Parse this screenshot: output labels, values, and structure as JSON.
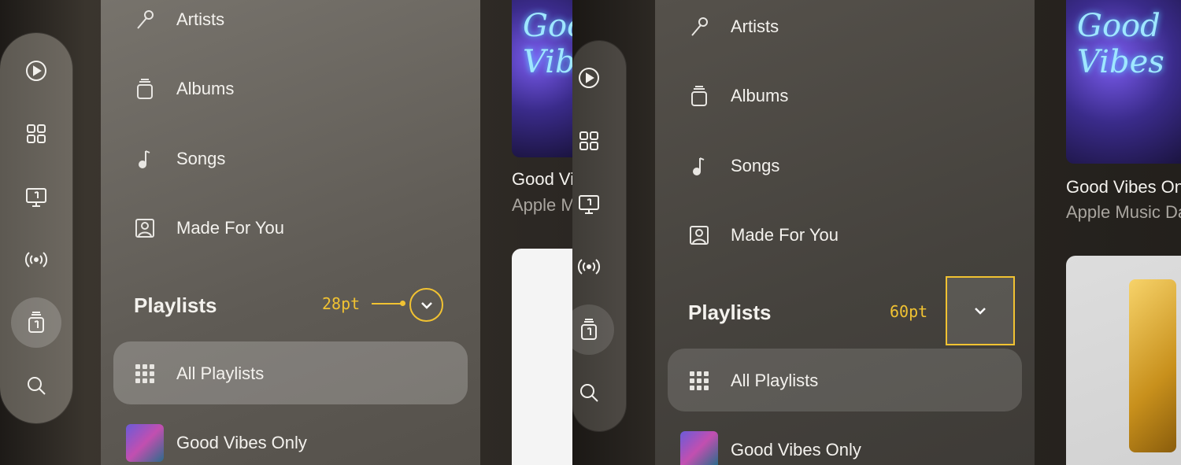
{
  "sidebar": {
    "items": [
      {
        "label": "Artists",
        "icon": "microphone-icon"
      },
      {
        "label": "Albums",
        "icon": "albums-icon"
      },
      {
        "label": "Songs",
        "icon": "music-note-icon"
      },
      {
        "label": "Made For You",
        "icon": "person-square-icon"
      }
    ],
    "playlists_heading": "Playlists",
    "all_playlists": "All Playlists",
    "playlist_1": "Good Vibes Only"
  },
  "tabs": [
    "play-icon",
    "grid-icon",
    "music-video-icon",
    "radio-icon",
    "library-icon",
    "search-icon"
  ],
  "annotations": {
    "left": "28pt",
    "right": "60pt",
    "color": "#f1c232"
  },
  "content": {
    "album_title": "Good Vibes Only",
    "album_artist": "Apple Music Dance",
    "art_text": "Good Vibes"
  }
}
